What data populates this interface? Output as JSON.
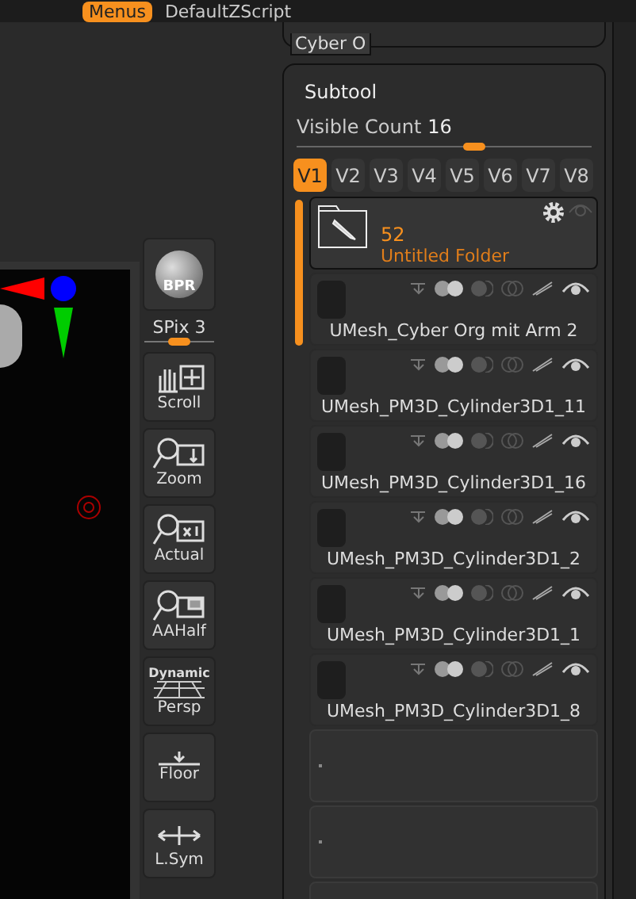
{
  "top_bar": {
    "menus": [
      {
        "label": "Menus",
        "selected": true
      },
      {
        "label": "DefaultZScript",
        "selected": false
      }
    ]
  },
  "tool_panel": {
    "thumbnail_label": "Cyber O"
  },
  "toolbar": [
    {
      "kind": "bpr",
      "label": "BPR"
    },
    {
      "kind": "slider",
      "label": "SPix 3",
      "level": 0.5
    },
    {
      "kind": "scroll",
      "label": "Scroll"
    },
    {
      "kind": "zoom",
      "label": "Zoom"
    },
    {
      "kind": "actual",
      "label": "Actual"
    },
    {
      "kind": "aahalf",
      "label": "AAHalf"
    },
    {
      "kind": "persp",
      "top": "Dynamic",
      "label": "Persp"
    },
    {
      "kind": "floor",
      "label": "Floor"
    },
    {
      "kind": "lsym",
      "label": "L.Sym"
    }
  ],
  "subtool": {
    "title": "Subtool",
    "visible_count": {
      "label": "Visible Count",
      "value": "16",
      "level": 0.6
    },
    "versions": [
      {
        "label": "V1",
        "selected": true
      },
      {
        "label": "V2",
        "selected": false
      },
      {
        "label": "V3",
        "selected": false
      },
      {
        "label": "V4",
        "selected": false
      },
      {
        "label": "V5",
        "selected": false
      },
      {
        "label": "V6",
        "selected": false
      },
      {
        "label": "V7",
        "selected": false
      },
      {
        "label": "V8",
        "selected": false
      }
    ],
    "folder": {
      "count": "52",
      "name": "Untitled Folder"
    },
    "items": [
      {
        "kind": "mesh",
        "name": "UMesh_Cyber Org mit Arm 2",
        "visible": true
      },
      {
        "kind": "mesh",
        "name": "UMesh_PM3D_Cylinder3D1_11",
        "visible": true
      },
      {
        "kind": "mesh",
        "name": "UMesh_PM3D_Cylinder3D1_16",
        "visible": true
      },
      {
        "kind": "mesh",
        "name": "UMesh_PM3D_Cylinder3D1_2",
        "visible": true
      },
      {
        "kind": "mesh",
        "name": "UMesh_PM3D_Cylinder3D1_1",
        "visible": true
      },
      {
        "kind": "mesh",
        "name": "UMesh_PM3D_Cylinder3D1_8",
        "visible": true
      },
      {
        "kind": "empty"
      },
      {
        "kind": "empty"
      },
      {
        "kind": "empty"
      }
    ]
  }
}
